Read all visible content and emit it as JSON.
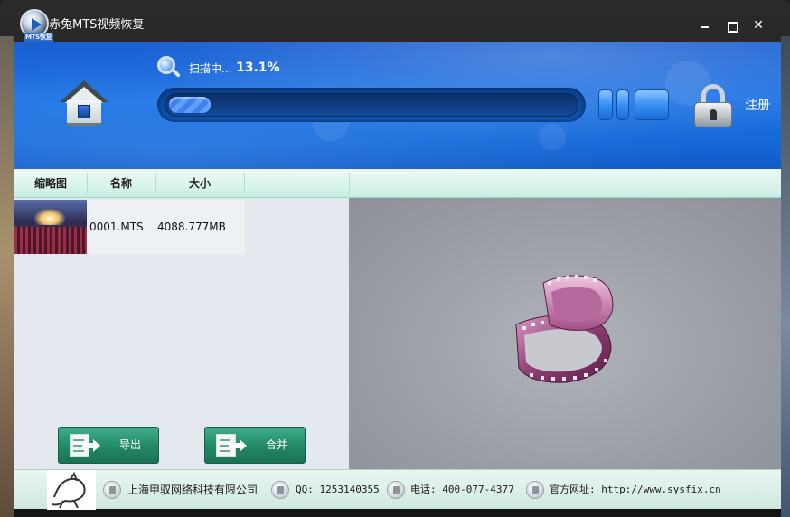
{
  "window": {
    "title": "赤兔MTS视频恢复",
    "logo_text": "MTS恢复"
  },
  "header": {
    "scan_label": "扫描中...",
    "scan_percent": "13.1%",
    "progress_fraction": 0.131,
    "register_label": "注册"
  },
  "table": {
    "columns": [
      "缩略图",
      "名称",
      "大小"
    ],
    "rows": [
      {
        "name": "0001.MTS",
        "size": "4088.777MB"
      }
    ]
  },
  "actions": {
    "export_label": "导出",
    "merge_label": "合并"
  },
  "footer": {
    "company": "上海甲驭网络科技有限公司",
    "qq": "QQ: 1253140355",
    "phone": "电话: 400-077-4377",
    "website": "官方网址: http://www.sysfix.cn"
  },
  "colors": {
    "header_blue": "#1f74e4",
    "button_green": "#228866",
    "table_header": "#c9eee2"
  },
  "icons": [
    "home-icon",
    "search-icon",
    "pause-icon",
    "lock-icon",
    "export-icon",
    "merge-icon",
    "film-reel-icon",
    "building-icon",
    "qq-icon",
    "phone-icon",
    "globe-icon"
  ]
}
